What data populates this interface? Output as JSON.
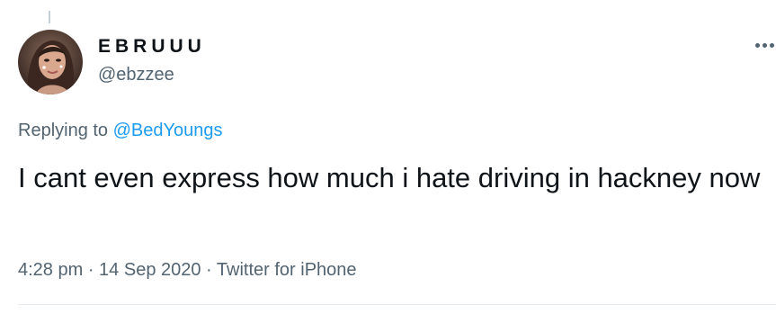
{
  "tweet": {
    "author": {
      "display_name": "EBRUUU",
      "handle": "@ebzzee"
    },
    "reply": {
      "prefix": "Replying to ",
      "mention": "@BedYoungs"
    },
    "text": "I cant even express how much i hate driving in hackney now",
    "meta": {
      "time": "4:28 pm",
      "separator": " · ",
      "date": "14 Sep 2020",
      "source": "Twitter for iPhone"
    },
    "icons": {
      "more": "more-horizontal-icon",
      "avatar": "profile-photo"
    }
  },
  "colors": {
    "text": "#0f1419",
    "secondary": "#536471",
    "link": "#1d9bf0",
    "divider": "#e6ecf0"
  }
}
